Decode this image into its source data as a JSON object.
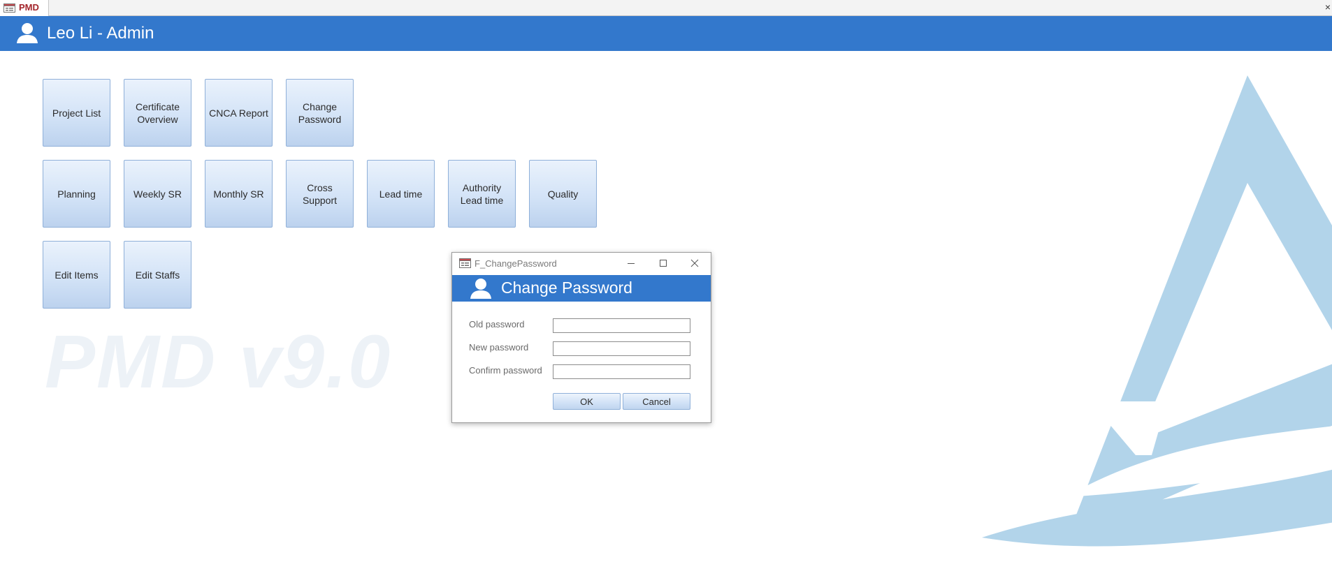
{
  "tab": {
    "label": "PMD",
    "icon": "form-icon"
  },
  "header": {
    "title": "Leo Li - Admin",
    "icon": "user-icon"
  },
  "watermark": "PMD v9.0",
  "menu": {
    "row1": [
      "Project List",
      "Certificate Overview",
      "CNCA Report",
      "Change Password"
    ],
    "row2": [
      "Planning",
      "Weekly SR",
      "Monthly SR",
      "Cross Support",
      "Lead time",
      "Authority Lead time",
      "Quality"
    ],
    "row3": [
      "Edit Items",
      "Edit Staffs"
    ]
  },
  "dialog": {
    "window_title": "F_ChangePassword",
    "heading": "Change Password",
    "fields": {
      "old_password": {
        "label": "Old password",
        "value": ""
      },
      "new_password": {
        "label": "New password",
        "value": ""
      },
      "confirm_password": {
        "label": "Confirm password",
        "value": ""
      }
    },
    "ok_label": "OK",
    "cancel_label": "Cancel"
  },
  "colors": {
    "header_blue": "#3378cc",
    "logo_blue": "#b2d4ea",
    "tab_label_red": "#a4262c"
  }
}
